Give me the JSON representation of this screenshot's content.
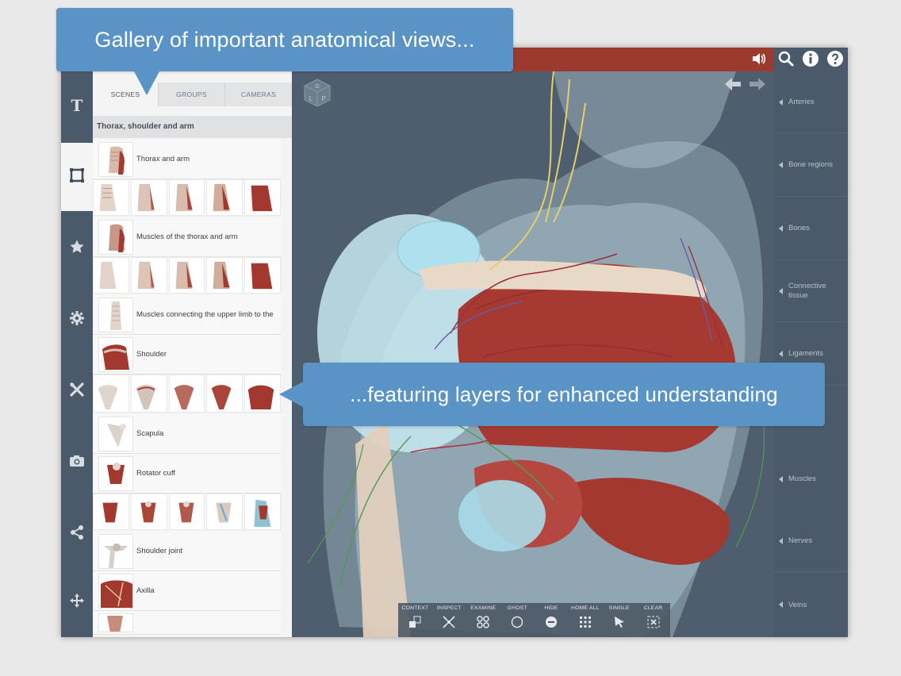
{
  "callouts": {
    "top": "Gallery of important anatomical views...",
    "middle": "...featuring layers for enhanced understanding"
  },
  "topbar": {
    "accent": "#9c3a2f",
    "icons": [
      "speaker-icon",
      "search-icon",
      "info-icon",
      "help-icon"
    ]
  },
  "rail": {
    "items": [
      "text-icon",
      "selection-icon",
      "star-icon",
      "gear-icon",
      "tools-icon",
      "camera-icon",
      "share-icon",
      "move-icon"
    ],
    "active": "selection-icon"
  },
  "panel": {
    "tabs": [
      {
        "label": "SCENES",
        "active": true
      },
      {
        "label": "GROUPS",
        "active": false
      },
      {
        "label": "CAMERAS",
        "active": false
      }
    ],
    "section_title": "Thorax, shoulder and arm",
    "rows": [
      {
        "label": "Thorax and arm"
      },
      {
        "label": "Muscles of the thorax and arm"
      },
      {
        "label": "Muscles connecting the upper limb to the"
      },
      {
        "label": "Shoulder"
      },
      {
        "label": "Scapula"
      },
      {
        "label": "Rotator cuff"
      },
      {
        "label": "Shoulder joint"
      },
      {
        "label": "Axilla"
      }
    ]
  },
  "viewport": {
    "cube_letters": [
      "G",
      "L",
      "P"
    ]
  },
  "categories": [
    "Arteries",
    "Bone regions",
    "Bones",
    "Connective tissue",
    "Ligaments",
    "Muscles",
    "Nerves",
    "Veins"
  ],
  "toolbar": {
    "items": [
      "CONTEXT",
      "INSPECT",
      "EXAMINE",
      "GHOST",
      "HIDE",
      "HOME ALL",
      "SINGLE",
      "CLEAR"
    ]
  }
}
